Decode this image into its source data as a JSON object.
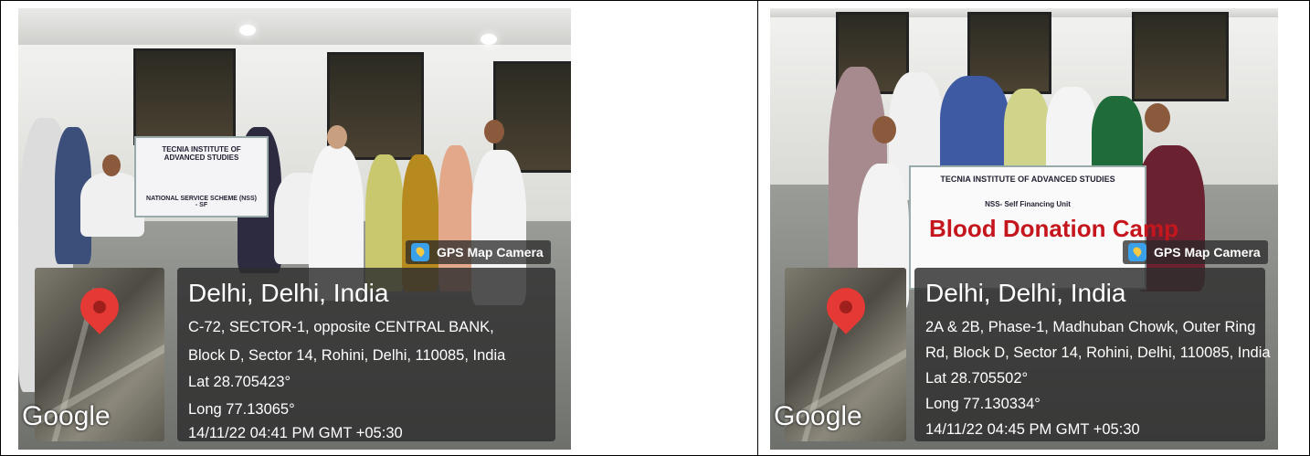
{
  "left_photo": {
    "banner_title": "TECNIA INSTITUTE OF ADVANCED STUDIES",
    "banner_subtitle": "NATIONAL SERVICE SCHEME (NSS) - SF",
    "gps_tag": "GPS Map Camera",
    "map_brand": "Google",
    "city": "Delhi, Delhi, India",
    "address_lines": [
      "C-72, SECTOR-1, opposite CENTRAL BANK,",
      "Block D, Sector 14, Rohini, Delhi, 110085, India"
    ],
    "lat": "Lat 28.705423°",
    "long": "Long 77.13065°",
    "timestamp": "14/11/22 04:41 PM GMT +05:30"
  },
  "right_photo": {
    "banner_title": "TECNIA INSTITUTE OF ADVANCED STUDIES",
    "banner_subtitle": "NSS- Self Financing Unit",
    "banner_headline": "Blood Donation Camp",
    "gps_tag": "GPS Map Camera",
    "map_brand": "Google",
    "city": "Delhi, Delhi, India",
    "address_lines": [
      "2A & 2B, Phase-1, Madhuban Chowk, Outer Ring",
      "Rd, Block D, Sector 14, Rohini, Delhi, 110085, India"
    ],
    "lat": "Lat 28.705502°",
    "long": "Long 77.130334°",
    "timestamp": "14/11/22 04:45 PM GMT +05:30"
  }
}
